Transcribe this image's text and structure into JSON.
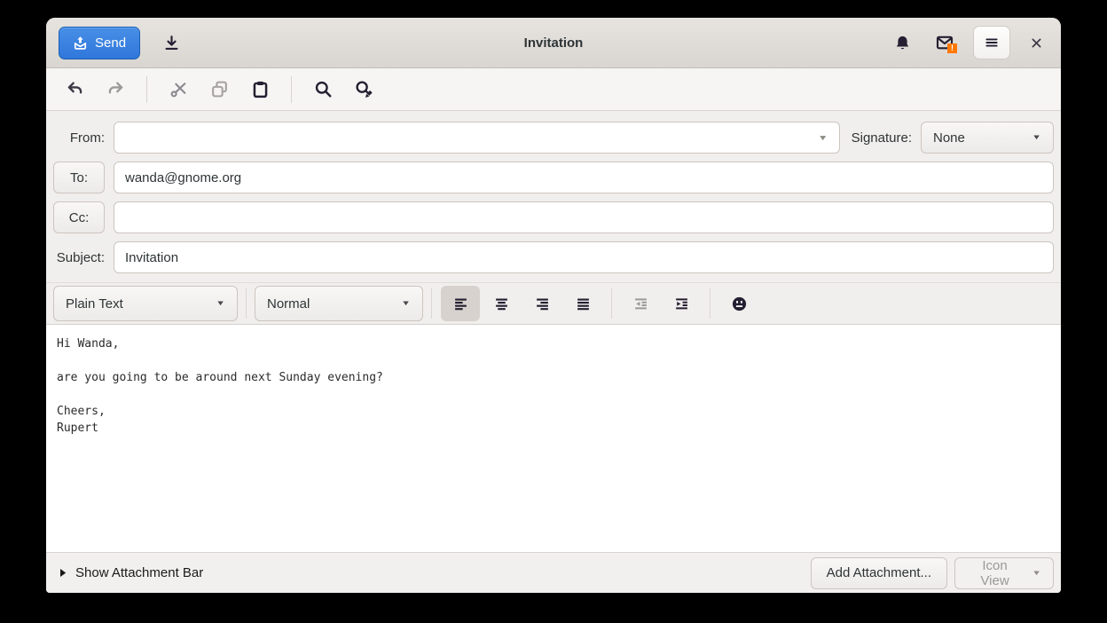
{
  "window": {
    "title": "Invitation"
  },
  "header": {
    "send_label": "Send"
  },
  "fields": {
    "from_label": "From:",
    "from_value": "",
    "signature_label": "Signature:",
    "signature_value": "None",
    "to_label": "To:",
    "to_value": "wanda@gnome.org",
    "cc_label": "Cc:",
    "cc_value": "",
    "subject_label": "Subject:",
    "subject_value": "Invitation"
  },
  "format_toolbar": {
    "mode": "Plain Text",
    "paragraph_style": "Normal"
  },
  "body": {
    "text": "Hi Wanda,\n\nare you going to be around next Sunday evening?\n\nCheers,\nRupert"
  },
  "footer": {
    "expander_label": "Show Attachment Bar",
    "add_attachment_label": "Add Attachment...",
    "view_mode_label": "Icon View"
  },
  "icons": {
    "dropdown_arrow": "▼",
    "badge_glyph": "!"
  },
  "colors": {
    "accent_blue": "#3584e4",
    "badge_orange": "#ff7800",
    "icon_dark": "#241f31",
    "icon_disabled": "#9a9996"
  }
}
